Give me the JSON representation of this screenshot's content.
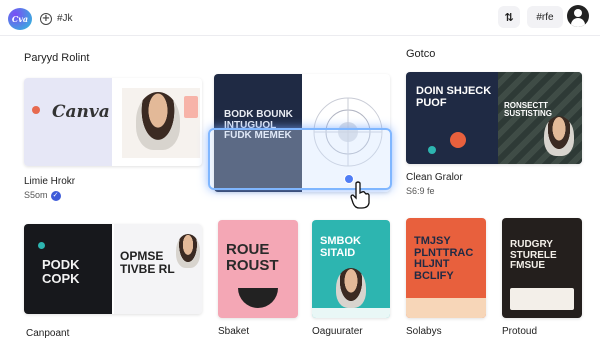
{
  "topbar": {
    "logo_text": "Cva",
    "add_label": "+",
    "title": "#Jk",
    "swap_icon": "swap-icon",
    "tag_label": "#rfe",
    "avatar_icon": "user-icon"
  },
  "sections": {
    "left_title": "Paryyd Rolint",
    "right_title": "Gotco"
  },
  "cards": [
    {
      "caption": "Limie Hrokr",
      "sub": "S5om",
      "verified": true,
      "art_text": "Canva"
    },
    {
      "caption": "",
      "sub": "",
      "art_text": "BODK BOUNK INTUGUOL FUDK MEMEK"
    },
    {
      "caption": "Clean Gralor",
      "sub": "S6:9 fe",
      "art_text": "DOIN SHJECK PUOF"
    },
    {
      "art_text_2": "RONSECTT SUSTISTING"
    },
    {
      "caption": "Canpoant",
      "art_text": "PODK COPK",
      "art_text_2": "OPMSE TIVBE RL"
    },
    {
      "caption": "Sbaket",
      "art_text": "ROUE ROUST"
    },
    {
      "caption": "Oaguurater",
      "art_text": "SMBOK SITAID"
    },
    {
      "caption": "Solabys",
      "art_text": "TMJSY PLNTTRAC HLJNT BCLIFY"
    },
    {
      "caption": "Protoud",
      "art_text": "RUDGRY STURELE FMSUE"
    }
  ],
  "colors": {
    "accent": "#3d5bd9",
    "selection": "#7fb6ff",
    "navy": "#1f2a44",
    "coral": "#e8603d",
    "teal": "#2db5b0",
    "pink": "#f4a7b5"
  }
}
